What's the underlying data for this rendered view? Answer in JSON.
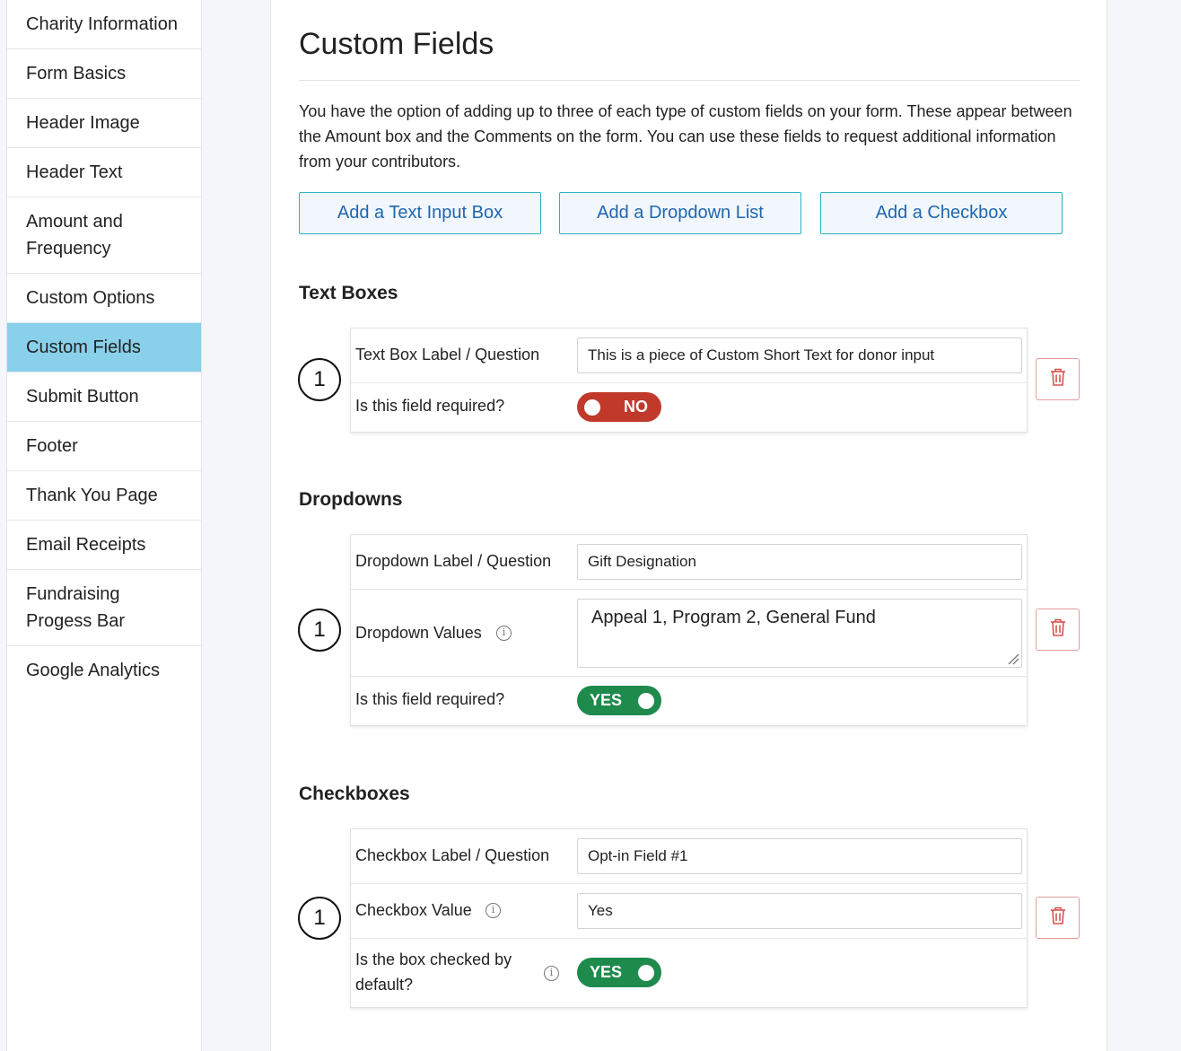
{
  "sidebar": {
    "items": [
      {
        "label": "Charity Information",
        "active": false
      },
      {
        "label": "Form Basics",
        "active": false
      },
      {
        "label": "Header Image",
        "active": false
      },
      {
        "label": "Header Text",
        "active": false
      },
      {
        "label": "Amount and Frequency",
        "active": false
      },
      {
        "label": "Custom Options",
        "active": false
      },
      {
        "label": "Custom Fields",
        "active": true
      },
      {
        "label": "Submit Button",
        "active": false
      },
      {
        "label": "Footer",
        "active": false
      },
      {
        "label": "Thank You Page",
        "active": false
      },
      {
        "label": "Email Receipts",
        "active": false
      },
      {
        "label": "Fundraising Progess Bar",
        "active": false
      },
      {
        "label": "Google Analytics",
        "active": false
      }
    ],
    "active_color": "#89d0ea"
  },
  "main": {
    "title": "Custom Fields",
    "intro": "You have the option of adding up to three of each type of custom fields on your form. These appear between the Amount box and the Comments on the form. You can use these fields to request additional information from your contributors.",
    "buttons": {
      "add_text": "Add a Text Input Box",
      "add_dropdown": "Add a Dropdown List",
      "add_checkbox": "Add a Checkbox"
    },
    "text_boxes": {
      "heading": "Text Boxes",
      "item": {
        "number": "1",
        "label_caption": "Text Box Label / Question",
        "label_value": "This is a piece of Custom Short Text for donor input",
        "required_caption": "Is this field required?",
        "required_toggle": "NO"
      }
    },
    "dropdowns": {
      "heading": "Dropdowns",
      "item": {
        "number": "1",
        "label_caption": "Dropdown Label / Question",
        "label_value": "Gift Designation",
        "values_caption": "Dropdown Values",
        "values_value": "Appeal 1, Program 2, General Fund",
        "required_caption": "Is this field required?",
        "required_toggle": "YES"
      }
    },
    "checkboxes": {
      "heading": "Checkboxes",
      "item": {
        "number": "1",
        "label_caption": "Checkbox Label / Question",
        "label_value": "Opt-in Field #1",
        "value_caption": "Checkbox Value",
        "value_value": "Yes",
        "default_caption": "Is the box checked by default?",
        "default_toggle": "YES"
      }
    }
  },
  "colors": {
    "toggle_no": "#c0392b",
    "toggle_yes": "#1e8a4c",
    "button_text": "#1f66b0",
    "button_border": "#2bb3c0",
    "delete_icon": "#d9534f"
  },
  "icons": {
    "info": "info-circle-icon",
    "delete": "trash-icon"
  }
}
